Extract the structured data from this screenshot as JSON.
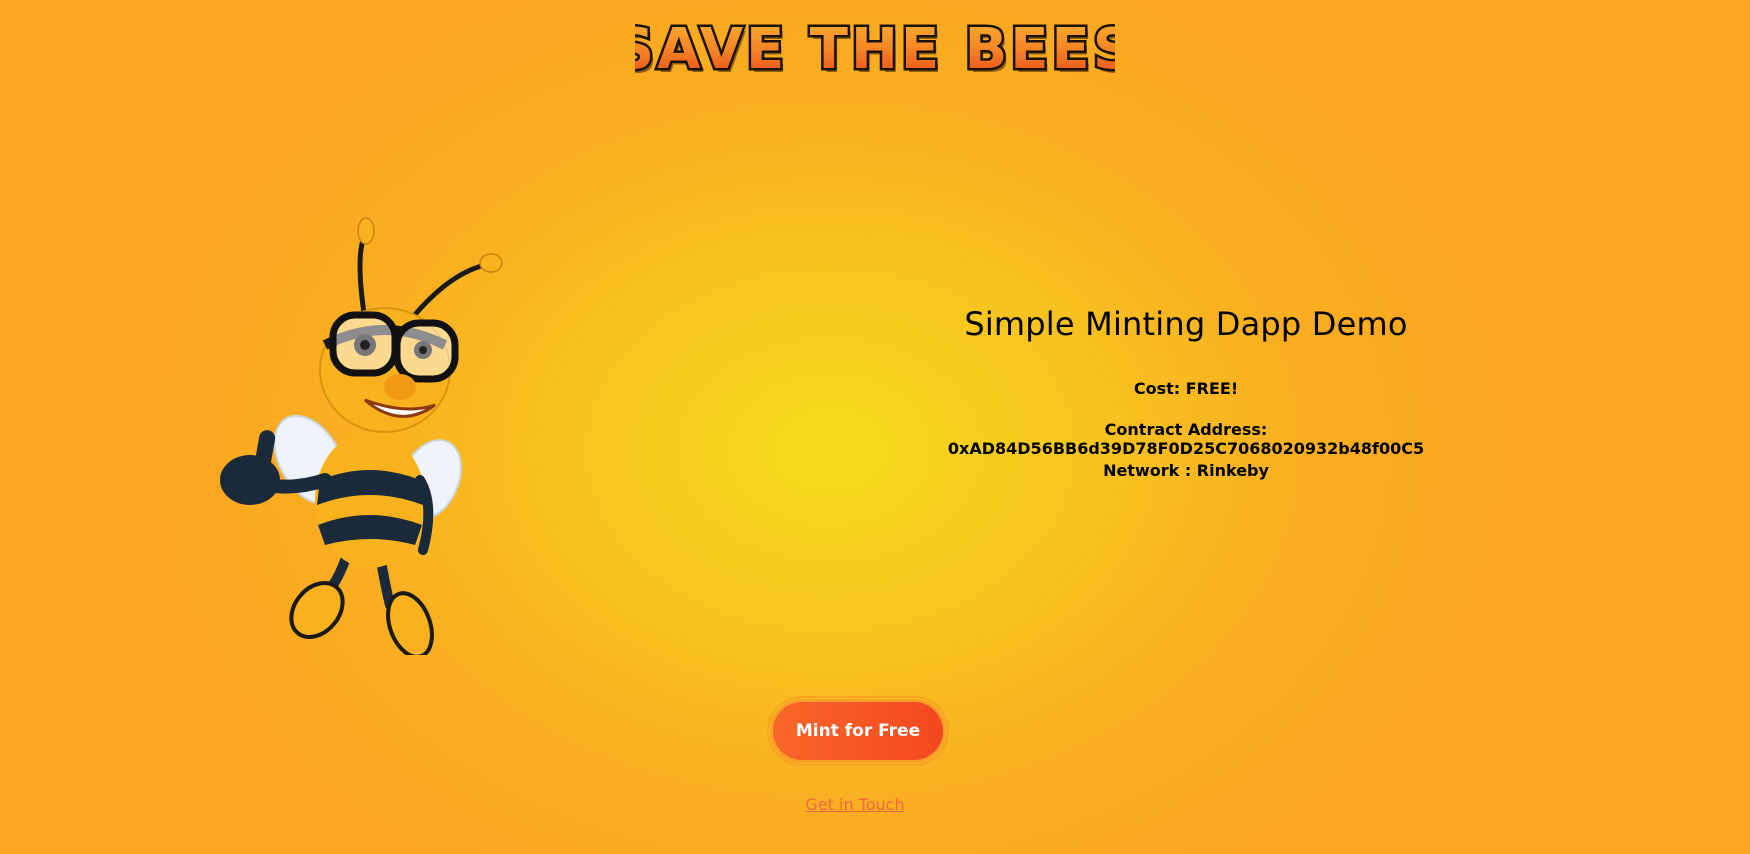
{
  "header": {
    "logo_text": "SAVE THE BEES"
  },
  "main": {
    "title": "Simple Minting Dapp Demo",
    "cost": "Cost: FREE!",
    "contract": "Contract Address: 0xAD84D56BB6d39D78F0D25C7068020932b48f00C5",
    "network": "Network : Rinkeby"
  },
  "actions": {
    "mint_label": "Mint for Free",
    "contact_label": "Get in Touch"
  },
  "colors": {
    "background_center": "#f5dc1a",
    "background_edge": "#fba421",
    "logo_fill": "#f26a1e",
    "button": "#f4471f",
    "link": "#ee6a43"
  }
}
